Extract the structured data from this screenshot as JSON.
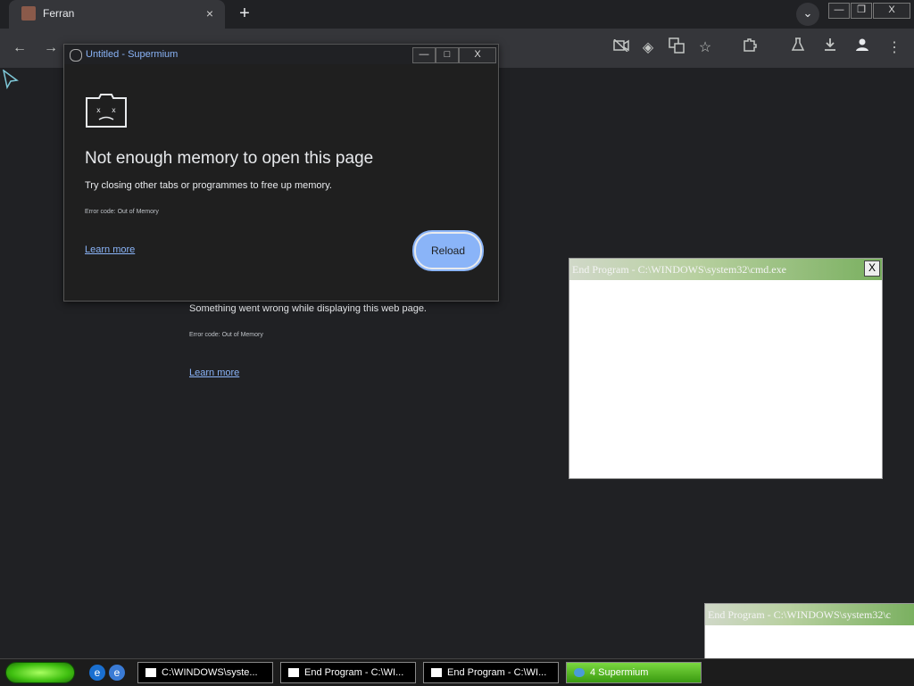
{
  "tab": {
    "title": "Ferran",
    "close": "×"
  },
  "new_tab_label": "+",
  "tab_search": "⌄",
  "window_controls": {
    "minimize": "—",
    "restore": "❐",
    "close": "X"
  },
  "page": {
    "message": "Something went wrong while displaying this web page.",
    "error_code": "Error code: Out of Memory",
    "learn_more": "Learn more"
  },
  "popup": {
    "title": "Untitled - Supermium",
    "heading": "Not enough memory to open this page",
    "message": "Try closing other tabs or programmes to free up memory.",
    "error_code": "Error code: Out of Memory",
    "learn_more": "Learn more",
    "reload": "Reload",
    "controls": {
      "minimize": "—",
      "maximize": "□",
      "close": "X"
    }
  },
  "end_program_1": {
    "title": "End Program - C:\\WINDOWS\\system32\\cmd.exe",
    "close": "X"
  },
  "end_program_2": {
    "title": "End Program - C:\\WINDOWS\\system32\\c"
  },
  "taskbar": {
    "tasks": [
      {
        "label": "C:\\WINDOWS\\syste..."
      },
      {
        "label": "End Program - C:\\WI..."
      },
      {
        "label": "End Program - C:\\WI..."
      },
      {
        "label": "4 Supermium"
      }
    ]
  },
  "colors": {
    "accent": "#8ab4f8",
    "background": "#202124",
    "taskbar_active": "#3a9a10"
  }
}
